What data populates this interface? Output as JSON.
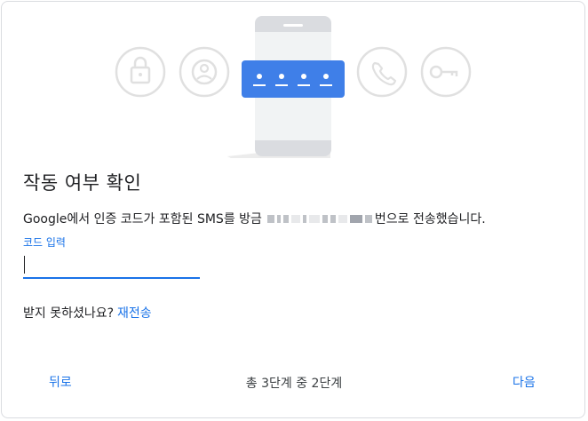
{
  "hero": {
    "icons": [
      "lock-icon",
      "account-icon",
      "phone-icon",
      "key-icon"
    ],
    "code_mask": "••••",
    "accent_color": "#4285f4"
  },
  "title": "작동 여부 확인",
  "message": {
    "before": "Google에서 인증 코드가 포함된 SMS를 방금",
    "after": "번으로 전송했습니다."
  },
  "code_field": {
    "label": "코드 입력",
    "value": ""
  },
  "resend": {
    "prompt": "받지 못하셨나요?",
    "link": "재전송"
  },
  "footer": {
    "back": "뒤로",
    "step": "총 3단계 중 2단계",
    "next": "다음"
  }
}
